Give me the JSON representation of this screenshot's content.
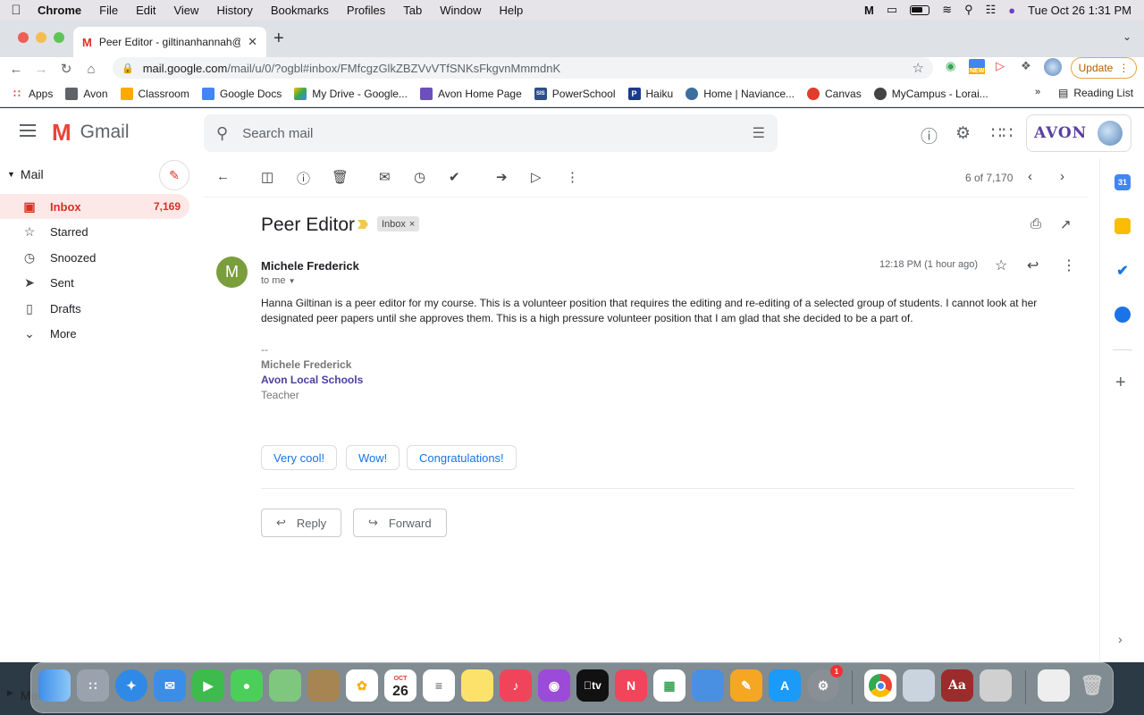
{
  "menubar": {
    "app": "Chrome",
    "items": [
      "File",
      "Edit",
      "View",
      "History",
      "Bookmarks",
      "Profiles",
      "Tab",
      "Window",
      "Help"
    ],
    "datetime": "Tue Oct 26  1:31 PM"
  },
  "browser": {
    "tab_title": "Peer Editor - giltinanhannah@a",
    "url_host": "mail.google.com",
    "url_path": "/mail/u/0/?ogbl#inbox/FMfcgzGlkZBZVvVTfSNKsFkgvnMmmdnK",
    "update_label": "Update",
    "ext_new_badge": "NEW",
    "bookmarks": [
      {
        "label": "Apps",
        "icon": "apps-grid-icon",
        "color": "#1a73e8"
      },
      {
        "label": "Avon",
        "icon": "folder-icon",
        "color": "#5f6368"
      },
      {
        "label": "Classroom",
        "icon": "classroom-icon",
        "color": "#f9ab00"
      },
      {
        "label": "Google Docs",
        "icon": "docs-icon",
        "color": "#4285f4"
      },
      {
        "label": "My Drive - Google...",
        "icon": "drive-icon",
        "color": "#34a853"
      },
      {
        "label": "Avon Home Page",
        "icon": "avon-eagle-icon",
        "color": "#6b4fbb"
      },
      {
        "label": "PowerSchool",
        "icon": "powerschool-icon",
        "color": "#2d4f8b",
        "glyph": "SIS"
      },
      {
        "label": "Haiku",
        "icon": "haiku-icon",
        "color": "#1b3b8b",
        "glyph": "P"
      },
      {
        "label": "Home | Naviance...",
        "icon": "naviance-icon",
        "color": "#3c6e9e"
      },
      {
        "label": "Canvas",
        "icon": "canvas-icon",
        "color": "#e13c2b"
      },
      {
        "label": "MyCampus - Lorai...",
        "icon": "globe-icon",
        "color": "#444"
      }
    ],
    "bookmarks_overflow": "»",
    "reading_list": "Reading List"
  },
  "gmail": {
    "logo_text": "Gmail",
    "search_placeholder": "Search mail",
    "profile_org": "AVON",
    "sidebar": {
      "mail_label": "Mail",
      "items": [
        {
          "label": "Inbox",
          "count": "7,169",
          "icon": "inbox-icon"
        },
        {
          "label": "Starred",
          "count": "",
          "icon": "star-icon"
        },
        {
          "label": "Snoozed",
          "count": "",
          "icon": "clock-icon"
        },
        {
          "label": "Sent",
          "count": "",
          "icon": "send-icon"
        },
        {
          "label": "Drafts",
          "count": "",
          "icon": "draft-icon"
        },
        {
          "label": "More",
          "count": "",
          "icon": "chevron-down-icon"
        }
      ],
      "meet_label": "Meet"
    },
    "toolbar": {
      "counter": "6 of 7,170"
    },
    "email": {
      "subject": "Peer Editor",
      "label_chip": "Inbox",
      "sender": "Michele Frederick",
      "avatar_letter": "M",
      "to": "to me",
      "time": "12:18 PM (1 hour ago)",
      "body": "Hanna Giltinan is a peer editor for my course.  This is a volunteer position that requires the editing and re-editing of a selected group of students.  I cannot look at her designated peer papers until she approves them.  This is a high pressure volunteer position that I am glad that she decided to be a part of.",
      "signature": {
        "dash": "--",
        "name": "Michele Frederick",
        "school": "Avon Local Schools",
        "role": "Teacher"
      },
      "smart_replies": [
        "Very cool!",
        "Wow!",
        "Congratulations!"
      ],
      "reply_label": "Reply",
      "forward_label": "Forward"
    },
    "side_panel": {
      "calendar_day": "31"
    }
  },
  "dock": {
    "calendar_month": "OCT",
    "calendar_day": "26",
    "tv_label": "tv",
    "notification_badge": "1",
    "dictionary_glyph": "Aa"
  }
}
